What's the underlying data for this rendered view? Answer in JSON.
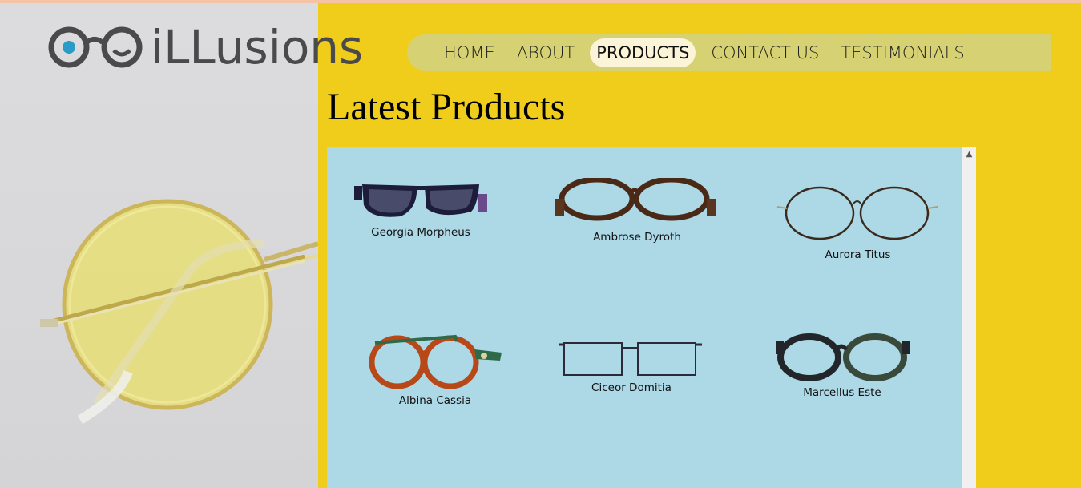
{
  "brand": {
    "name": "iLLusions"
  },
  "nav": {
    "items": [
      {
        "label": "HOME"
      },
      {
        "label": "ABOUT"
      },
      {
        "label": "PRODUCTS"
      },
      {
        "label": "CONTACT US"
      },
      {
        "label": "TESTIMONIALS"
      }
    ],
    "active": "PRODUCTS"
  },
  "main": {
    "title": "Latest Products",
    "products": [
      {
        "name": "Georgia Morpheus"
      },
      {
        "name": "Ambrose Dyroth"
      },
      {
        "name": "Aurora Titus"
      },
      {
        "name": "Albina Cassia"
      },
      {
        "name": "Ciceor Domitia"
      },
      {
        "name": "Marcellus Este"
      }
    ]
  },
  "colors": {
    "background": "#efcd1a",
    "nav_bar": "#d6d172",
    "nav_active": "#fbf4d9",
    "panel": "#add8e6",
    "logo_accent": "#2a9bc6"
  },
  "icons": {
    "scroll_up": "chevron-up-icon",
    "logo": "glasses-logo-icon"
  }
}
